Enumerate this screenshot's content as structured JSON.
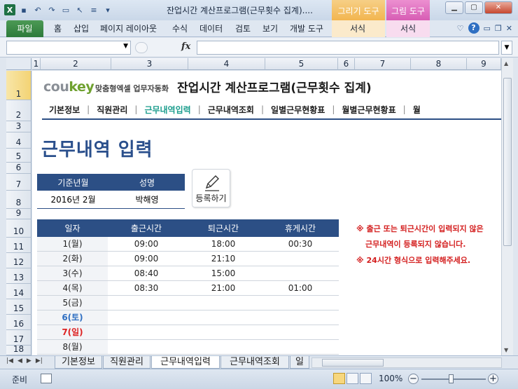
{
  "window": {
    "title": "잔업시간 계산프로그램(근무횟수 집계)....",
    "contextual_tabs": [
      "그리기 도구",
      "그림 도구"
    ]
  },
  "ribbon": {
    "file": "파일",
    "tabs": [
      "홈",
      "삽입",
      "페이지 레이아웃",
      "수식",
      "데이터",
      "검토",
      "보기",
      "개발 도구",
      "서식",
      "서식"
    ]
  },
  "columns": [
    "1",
    "2",
    "3",
    "4",
    "5",
    "6",
    "7",
    "8",
    "9"
  ],
  "rows": [
    "1",
    "2",
    "3",
    "4",
    "5",
    "6",
    "7",
    "8",
    "9",
    "10",
    "11",
    "12",
    "13",
    "14",
    "15",
    "16",
    "17",
    "18"
  ],
  "header": {
    "logo_main": "cou",
    "logo_key": "key",
    "logo_sub": "맞춤형엑셀 업무자동화",
    "app_title": "잔업시간 계산프로그램(근무횟수 집계)"
  },
  "menu": [
    "기본정보",
    "직원관리",
    "근무내역입력",
    "근무내역조회",
    "일별근무현황표",
    "월별근무현황표",
    "월"
  ],
  "page_heading": "근무내역 입력",
  "info": {
    "headers": [
      "기준년월",
      "성명"
    ],
    "values": [
      "2016년 2월",
      "박해영"
    ]
  },
  "register_button": "등록하기",
  "table": {
    "headers": [
      "일자",
      "출근시간",
      "퇴근시간",
      "휴게시간"
    ],
    "rows": [
      [
        "1(월)",
        "09:00",
        "18:00",
        "00:30"
      ],
      [
        "2(화)",
        "09:00",
        "21:10",
        ""
      ],
      [
        "3(수)",
        "08:40",
        "15:00",
        ""
      ],
      [
        "4(목)",
        "08:30",
        "21:00",
        "01:00"
      ],
      [
        "5(금)",
        "",
        "",
        ""
      ],
      [
        "6(토)",
        "",
        "",
        ""
      ],
      [
        "7(일)",
        "",
        "",
        ""
      ],
      [
        "8(월)",
        "",
        "",
        ""
      ]
    ]
  },
  "notes": [
    "※ 출근 또는 퇴근시간이 입력되지 않은",
    "근무내역이 등록되지 않습니다.",
    "※ 24시간 형식으로 입력해주세요."
  ],
  "sheet_tabs": [
    "기본정보",
    "직원관리",
    "근무내역입력",
    "근무내역조회",
    "일"
  ],
  "status": {
    "ready": "준비",
    "zoom": "100%"
  },
  "colors": {
    "accent_blue": "#2c4f85",
    "active_menu": "#1b9d8d",
    "note_red": "#d42020",
    "saturday": "#2f6fc2",
    "sunday": "#d22222"
  }
}
